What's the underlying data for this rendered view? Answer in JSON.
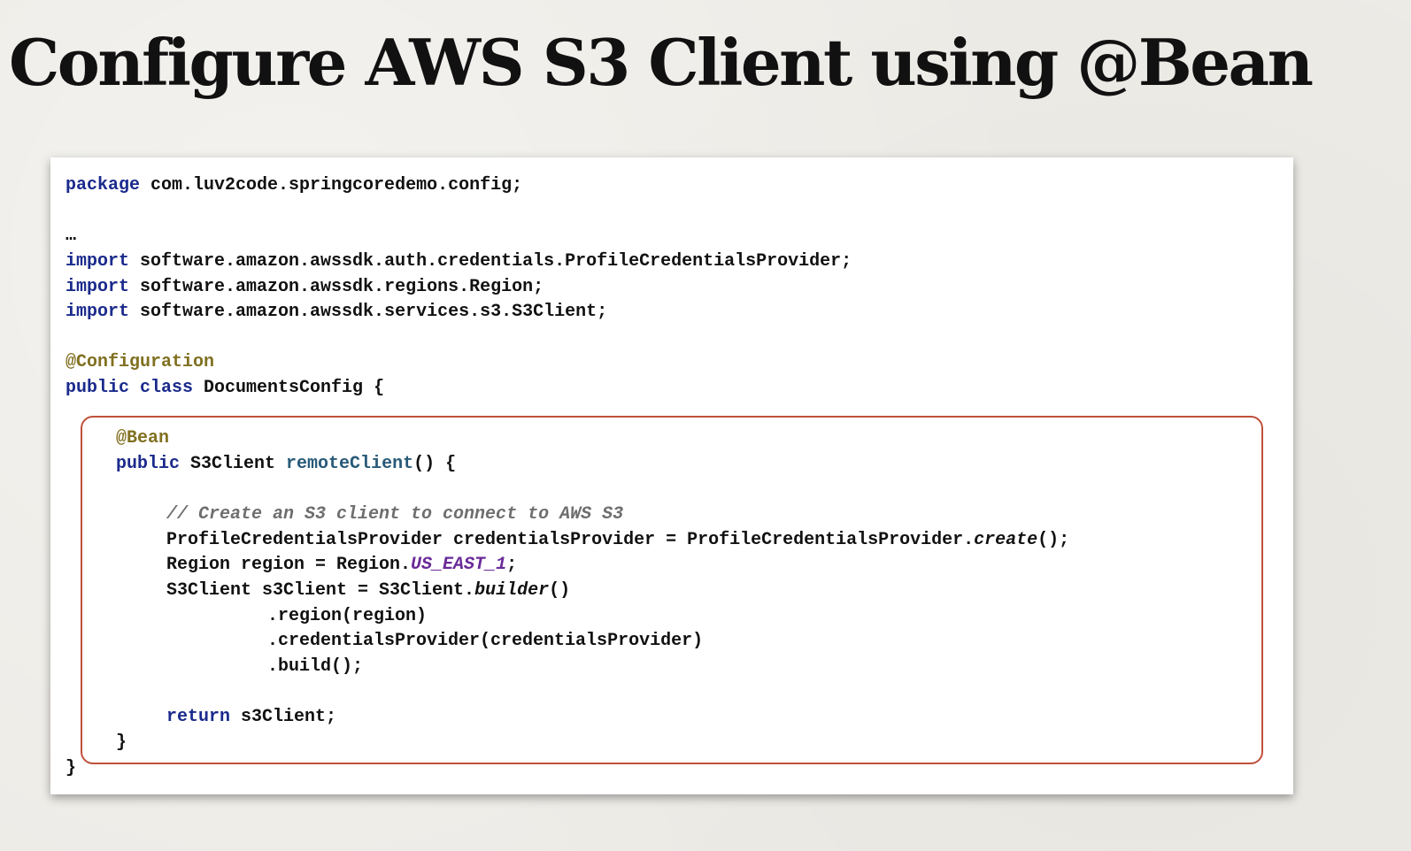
{
  "slide": {
    "title": "Configure AWS S3 Client using @Bean"
  },
  "colors": {
    "keyword": "#1a2a8c",
    "annotation": "#807020",
    "method": "#285a78",
    "comment": "#6e6e6e",
    "constant": "#6a2a98",
    "highlight_border": "#c0503c"
  },
  "code": {
    "line01": {
      "kw": "package",
      "rest": " com.luv2code.springcoredemo.config;"
    },
    "line02": {
      "text": "…"
    },
    "line03": {
      "kw": "import",
      "rest": " software.amazon.awssdk.auth.credentials.ProfileCredentialsProvider;"
    },
    "line04": {
      "kw": "import",
      "rest": " software.amazon.awssdk.regions.Region;"
    },
    "line05": {
      "kw": "import",
      "rest": " software.amazon.awssdk.services.s3.S3Client;"
    },
    "line06": {
      "ann": "@Configuration"
    },
    "line07": {
      "kw": "public class",
      "rest": " DocumentsConfig {"
    },
    "line08": {
      "ann": "@Bean"
    },
    "line09": {
      "kw": "public",
      "type": " S3Client ",
      "method": "remoteClient",
      "rest": "() {"
    },
    "line10": {
      "comment": "// Create an S3 client to connect to AWS S3"
    },
    "line11": {
      "pre": "ProfileCredentialsProvider credentialsProvider = ProfileCredentialsProvider.",
      "italic": "create",
      "post": "();"
    },
    "line12": {
      "pre": "Region region = Region.",
      "constant": "US_EAST_1",
      "post": ";"
    },
    "line13": {
      "pre": "S3Client s3Client = S3Client.",
      "italic": "builder",
      "post": "()"
    },
    "line14": {
      "text": ".region(region)"
    },
    "line15": {
      "text": ".credentialsProvider(credentialsProvider)"
    },
    "line16": {
      "text": ".build();"
    },
    "line17": {
      "kw": "return",
      "rest": " s3Client;"
    },
    "line18": {
      "text": "}"
    },
    "line19": {
      "text": "}"
    }
  }
}
